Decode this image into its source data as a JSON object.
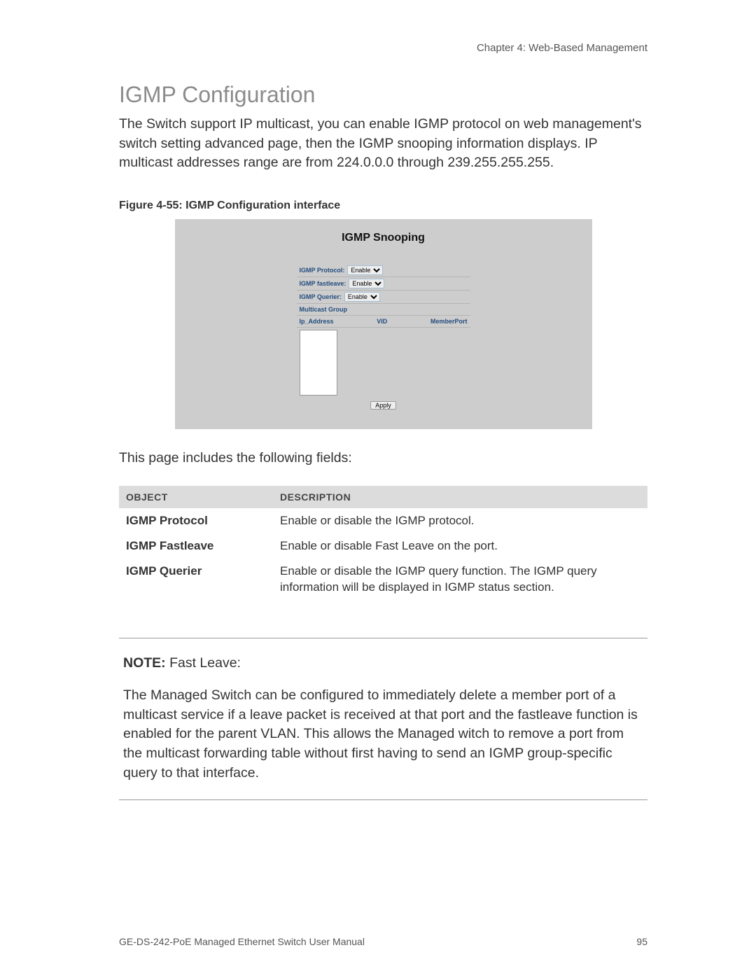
{
  "header": {
    "chapter": "Chapter 4: Web-Based Management"
  },
  "section": {
    "title": "IGMP Configuration",
    "intro": "The Switch support IP multicast, you can enable IGMP protocol on web management's switch setting advanced page, then the IGMP snooping information displays. IP multicast addresses range are from 224.0.0.0 through 239.255.255.255."
  },
  "figure": {
    "caption": "Figure 4-55: IGMP Configuration interface",
    "panel_title": "IGMP Snooping",
    "rows": {
      "protocol": {
        "label": "IGMP Protocol:",
        "value": "Enable"
      },
      "fastleave": {
        "label": "IGMP fastleave:",
        "value": "Enable"
      },
      "querier": {
        "label": "IGMP Querier:",
        "value": "Enable"
      }
    },
    "group_label": "Multicast Group",
    "columns": {
      "ip": "Ip_Address",
      "vid": "VID",
      "member": "MemberPort"
    },
    "apply_label": "Apply"
  },
  "fields": {
    "intro": "This page includes the following fields:",
    "headers": {
      "object": "OBJECT",
      "description": "DESCRIPTION"
    },
    "rows": [
      {
        "object": "IGMP Protocol",
        "description": "Enable or disable the IGMP protocol."
      },
      {
        "object": "IGMP Fastleave",
        "description": "Enable or disable Fast Leave on the port."
      },
      {
        "object": "IGMP Querier",
        "description": "Enable or disable the IGMP query function. The IGMP query information will be displayed in IGMP status section."
      }
    ]
  },
  "note": {
    "label": "NOTE:",
    "label_suffix": " Fast Leave:",
    "body": "The Managed Switch can be configured to immediately delete a member port of a multicast service if a leave packet is received at that port and the fastleave function is enabled for the parent VLAN. This allows the Managed witch to remove a port from the multicast forwarding table without first having to send an IGMP group-specific query to that interface."
  },
  "footer": {
    "manual": "GE-DS-242-PoE Managed Ethernet Switch User Manual",
    "page": "95"
  }
}
